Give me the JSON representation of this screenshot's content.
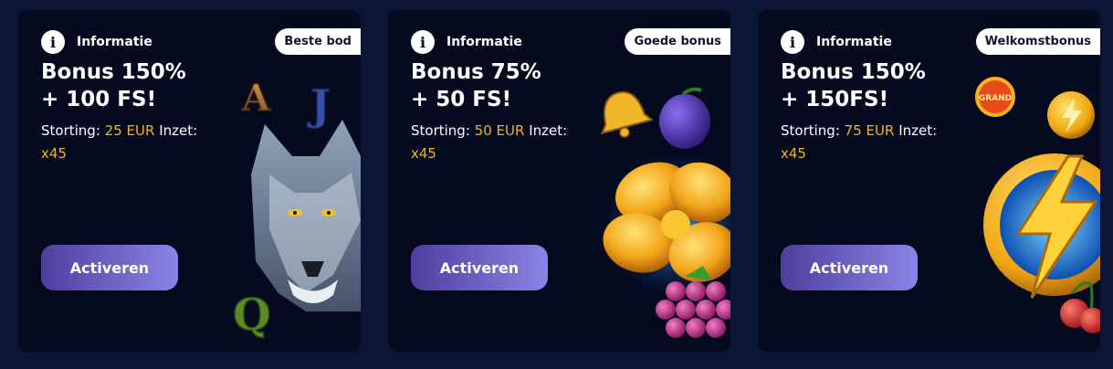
{
  "cards": [
    {
      "info_label": "Informatie",
      "badge": "Beste bod",
      "title_line1": "Bonus 150%",
      "title_line2": "+ 100 FS!",
      "deposit_label": "Storting:",
      "deposit_value": "25 EUR",
      "wager_label": "Inzet:",
      "wager_value": "x45",
      "button_label": "Activeren",
      "art_icons": [
        "letter-a-icon",
        "letter-j-icon",
        "wolf-icon",
        "letter-q-icon"
      ],
      "art_letters": {
        "a": "A",
        "j": "J",
        "q": "Q"
      }
    },
    {
      "info_label": "Informatie",
      "badge": "Goede bonus",
      "title_line1": "Bonus 75%",
      "title_line2": "+ 50 FS!",
      "deposit_label": "Storting:",
      "deposit_value": "50 EUR",
      "wager_label": "Inzet:",
      "wager_value": "x45",
      "button_label": "Activeren",
      "art_icons": [
        "bell-icon",
        "plum-icon",
        "golden-clover-icon",
        "grapes-icon"
      ]
    },
    {
      "info_label": "Informatie",
      "badge": "Welkomstbonus",
      "title_line1": "Bonus 150%",
      "title_line2": "+ 150FS!",
      "deposit_label": "Storting:",
      "deposit_value": "75 EUR",
      "wager_label": "Inzet:",
      "wager_value": "x45",
      "button_label": "Activeren",
      "art_icons": [
        "grand-coin-icon",
        "lightning-coin-icon",
        "lightning-coin-large-icon",
        "cherries-icon"
      ],
      "art_letters": {
        "grand": "GRAND"
      }
    }
  ],
  "colors": {
    "page_background": "#0c1535",
    "card_background": "#050a1e",
    "accent": "#f1b51c",
    "button_gradient_start": "#4f3e9e",
    "button_gradient_end": "#8a84e6"
  }
}
